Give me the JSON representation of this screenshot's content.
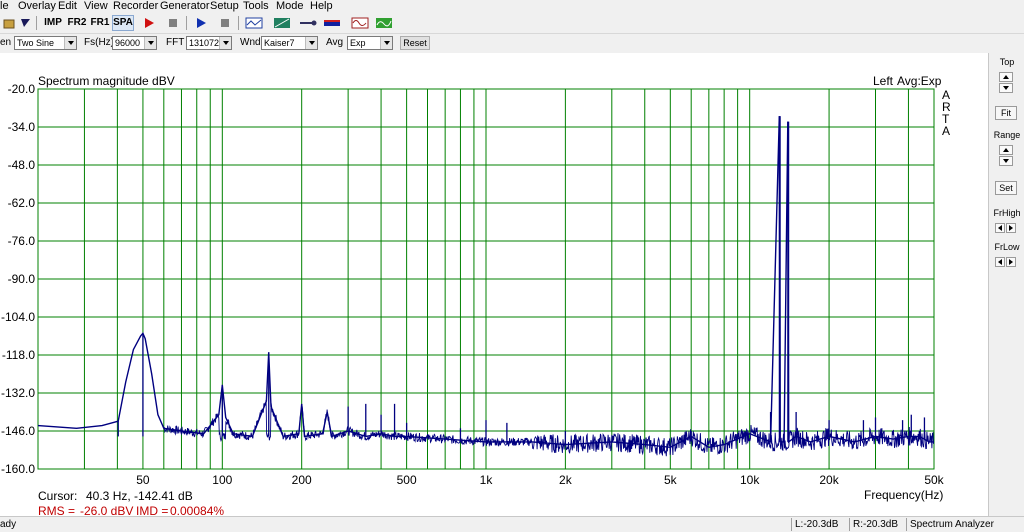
{
  "menu": [
    "le",
    "Overlay",
    "Edit",
    "View",
    "Recorder",
    "Generator",
    "Setup",
    "Tools",
    "Mode",
    "Help"
  ],
  "toolbar": {
    "imp_label": "IMP",
    "fr2_label": "FR2",
    "fr1_label": "FR1",
    "spa_label": "SPA"
  },
  "settings": {
    "gen_label": "en",
    "gen_value": "Two Sine",
    "fs_label": "Fs(Hz)",
    "fs_value": "96000",
    "fft_label": "FFT",
    "fft_value": "131072",
    "wnd_label": "Wnd",
    "wnd_value": "Kaiser7",
    "avg_label": "Avg",
    "avg_value": "Exp",
    "reset_label": "Reset"
  },
  "panel": {
    "top_label": "Top",
    "fit_label": "Fit",
    "range_label": "Range",
    "set_label": "Set",
    "frhigh_label": "FrHigh",
    "frlow_label": "FrLow"
  },
  "info": {
    "channel": "Left",
    "avg_mode": "Avg:Exp",
    "arta_letters": [
      "A",
      "R",
      "T",
      "A"
    ],
    "cursor_label": "Cursor:",
    "cursor_value": "40.3 Hz, -142.41 dB",
    "rms_label": "RMS =",
    "rms_value": "-26.0 dBV",
    "imd_label": "IMD =",
    "imd_value": "0.00084%"
  },
  "status": {
    "ready": "ady",
    "left_level": "L:-20.3dB",
    "right_level": "R:-20.3dB",
    "mode": "Spectrum Analyzer"
  },
  "colors": {
    "trace": "#000080",
    "grid": "#008000",
    "rms_text": "#c00000"
  },
  "chart_data": {
    "type": "line",
    "title": "Spectrum magnitude dBV",
    "xlabel": "Frequency(Hz)",
    "ylabel": "",
    "xscale": "log",
    "xlim": [
      20,
      50000
    ],
    "ylim": [
      -160,
      -20
    ],
    "x_tick_labels": [
      "50",
      "100",
      "200",
      "500",
      "1k",
      "2k",
      "5k",
      "10k",
      "20k",
      "50k"
    ],
    "y_tick_labels": [
      "-20.0",
      "-34.0",
      "-48.0",
      "-62.0",
      "-76.0",
      "-90.0",
      "-104.0",
      "-118.0",
      "-132.0",
      "-146.0",
      "-160.0"
    ],
    "grid": true,
    "series": [
      {
        "x": [
          20,
          28,
          35,
          40.3,
          43,
          46,
          49,
          50,
          51,
          54,
          57,
          60,
          70,
          85,
          97,
          100,
          103,
          110,
          130,
          147,
          150,
          153,
          170,
          195,
          200,
          205,
          240,
          250,
          260,
          300,
          350,
          400,
          450,
          500,
          700,
          1000,
          1500,
          2000,
          3000,
          4000,
          5000,
          6000,
          7000,
          8000,
          10000,
          12000,
          12950,
          13050,
          13500,
          13950,
          14050,
          15000,
          17000,
          20000,
          25000,
          30000,
          35000,
          40000,
          44000,
          48000,
          50000
        ],
        "y": [
          -144,
          -145,
          -144,
          -142.4,
          -128,
          -116,
          -111,
          -110,
          -112,
          -125,
          -140,
          -145,
          -146,
          -147,
          -140,
          -129,
          -141,
          -147,
          -148,
          -135,
          -117,
          -137,
          -148,
          -147,
          -136,
          -148,
          -147,
          -139,
          -148,
          -146,
          -148,
          -147,
          -148,
          -148,
          -149,
          -150,
          -150,
          -151,
          -150,
          -151,
          -152,
          -148,
          -152,
          -151,
          -147,
          -150,
          -30,
          -150,
          -150,
          -32,
          -150,
          -148,
          -150,
          -148,
          -150,
          -148,
          -149,
          -148,
          -148,
          -150,
          -150
        ]
      }
    ],
    "peaks": [
      {
        "x": 40.3,
        "y": -142.41
      },
      {
        "x": 50,
        "y": -110
      },
      {
        "x": 100,
        "y": -129
      },
      {
        "x": 150,
        "y": -117
      },
      {
        "x": 200,
        "y": -136
      },
      {
        "x": 250,
        "y": -139
      },
      {
        "x": 300,
        "y": -137
      },
      {
        "x": 350,
        "y": -136
      },
      {
        "x": 400,
        "y": -140
      },
      {
        "x": 450,
        "y": -136
      },
      {
        "x": 500,
        "y": -143
      },
      {
        "x": 800,
        "y": -145
      },
      {
        "x": 1000,
        "y": -142
      },
      {
        "x": 1200,
        "y": -143
      },
      {
        "x": 2000,
        "y": -146
      },
      {
        "x": 6000,
        "y": -146
      },
      {
        "x": 12000,
        "y": -139
      },
      {
        "x": 13000,
        "y": -30
      },
      {
        "x": 14000,
        "y": -32
      },
      {
        "x": 15000,
        "y": -139
      },
      {
        "x": 20000,
        "y": -142
      },
      {
        "x": 27000,
        "y": -142
      },
      {
        "x": 30000,
        "y": -141
      },
      {
        "x": 38000,
        "y": -142
      },
      {
        "x": 41000,
        "y": -140
      },
      {
        "x": 46000,
        "y": -141
      }
    ]
  }
}
